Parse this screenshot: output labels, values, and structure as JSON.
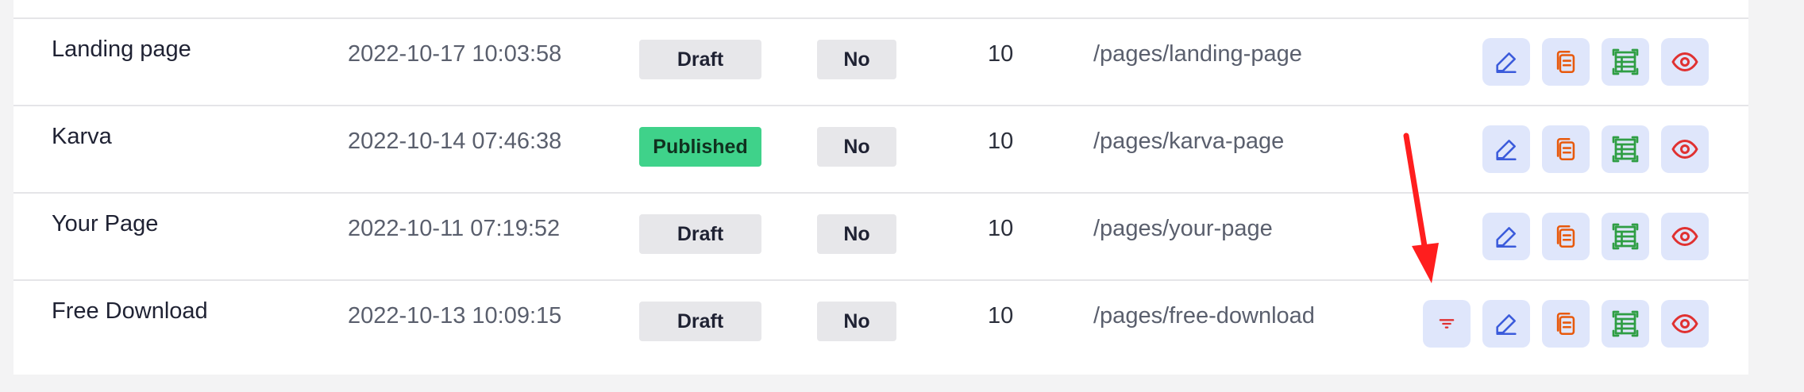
{
  "rows": [
    {
      "title": "Landing page",
      "date": "2022-10-17 10:03:58",
      "status": "Draft",
      "flag": "No",
      "count": "10",
      "path": "/pages/landing-page",
      "actions": [
        "edit-icon",
        "copy-icon",
        "layout-icon",
        "view-icon"
      ]
    },
    {
      "title": "Karva",
      "date": "2022-10-14 07:46:38",
      "status": "Published",
      "flag": "No",
      "count": "10",
      "path": "/pages/karva-page",
      "actions": [
        "edit-icon",
        "copy-icon",
        "layout-icon",
        "view-icon"
      ]
    },
    {
      "title": "Your Page",
      "date": "2022-10-11 07:19:52",
      "status": "Draft",
      "flag": "No",
      "count": "10",
      "path": "/pages/your-page",
      "actions": [
        "edit-icon",
        "copy-icon",
        "layout-icon",
        "view-icon"
      ]
    },
    {
      "title": "Free Download",
      "date": "2022-10-13 10:09:15",
      "status": "Draft",
      "flag": "No",
      "count": "10",
      "path": "/pages/free-download",
      "actions": [
        "filter-icon",
        "edit-icon",
        "copy-icon",
        "layout-icon",
        "view-icon"
      ]
    }
  ],
  "colors": {
    "edit": "#3b5bdb",
    "copy": "#e8590c",
    "layout": "#2f9e44",
    "view": "#e03131",
    "filter": "#e03131",
    "published": "#3fd28a",
    "annotation_arrow": "#ff1e1e"
  }
}
